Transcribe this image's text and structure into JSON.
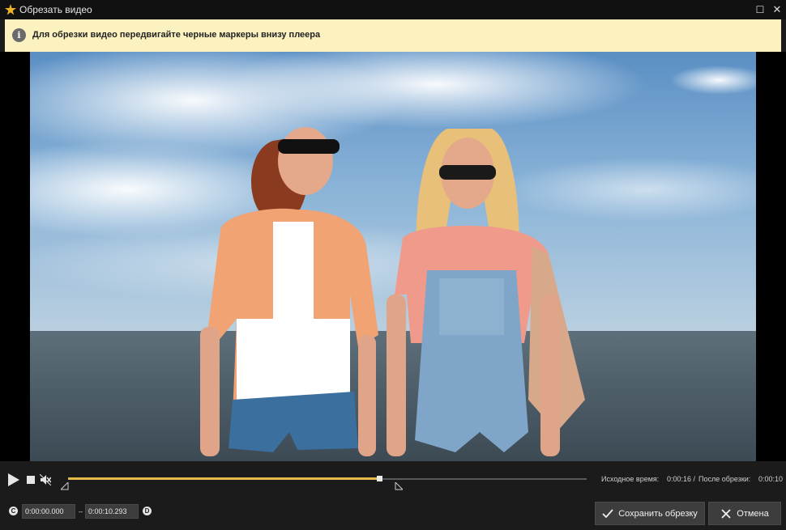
{
  "window": {
    "title": "Обрезать видео",
    "maximize_glyph": "☐",
    "close_glyph": "✕"
  },
  "info": {
    "icon_glyph": "i",
    "message": "Для обрезки видео передвигайте черные маркеры внизу плеера"
  },
  "video": {
    "description_icon": "video-frame"
  },
  "timeline": {
    "progress": 0.6,
    "trim_start": 0.0,
    "trim_end": 0.63
  },
  "times": {
    "source_label": "Исходное время:",
    "source_value": "0:00:16 /",
    "after_label": "После обрезки:",
    "after_value": "0:00:10"
  },
  "range": {
    "start_icon_glyph": "C",
    "start_value": "0:00:00.000",
    "separator": "–",
    "end_value": "0:00:10.293",
    "end_icon_glyph": "D"
  },
  "buttons": {
    "save_label": "Сохранить обрезку",
    "cancel_label": "Отмена"
  }
}
